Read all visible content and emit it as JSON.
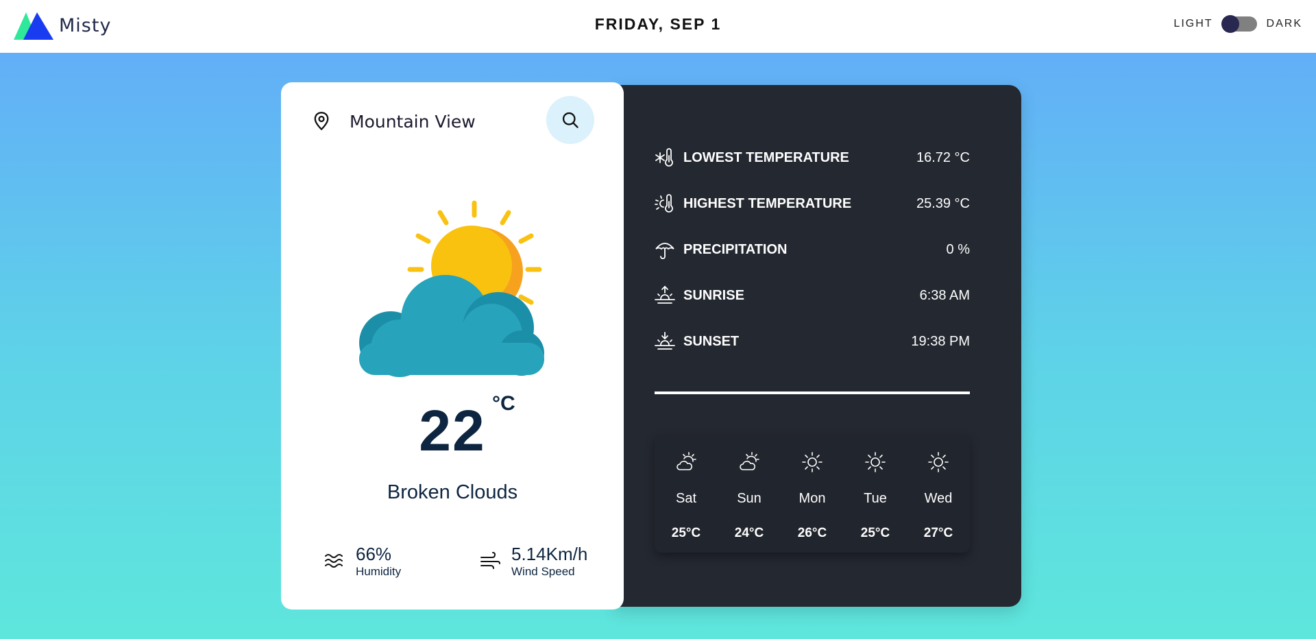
{
  "header": {
    "brand": "Misty",
    "date": "FRIDAY, SEP 1",
    "theme_light_label": "LIGHT",
    "theme_dark_label": "DARK"
  },
  "search": {
    "value": "Mountain View",
    "icons": {
      "location": "map-pin-icon",
      "search": "search-icon"
    }
  },
  "current": {
    "temperature": "22",
    "unit": "°C",
    "condition": "Broken Clouds",
    "icon": "sun-cloud-icon",
    "humidity": {
      "value": "66%",
      "label": "Humidity",
      "icon": "waves-icon"
    },
    "wind": {
      "value": "5.14Km/h",
      "label": "Wind Speed",
      "icon": "wind-icon"
    }
  },
  "details": [
    {
      "label": "LOWEST TEMPERATURE",
      "value": "16.72 °C",
      "icon": "thermometer-snow-icon"
    },
    {
      "label": "HIGHEST TEMPERATURE",
      "value": "25.39 °C",
      "icon": "thermometer-sun-icon"
    },
    {
      "label": "PRECIPITATION",
      "value": "0 %",
      "icon": "umbrella-icon"
    },
    {
      "label": "SUNRISE",
      "value": "6:38 AM",
      "icon": "sunrise-icon"
    },
    {
      "label": "SUNSET",
      "value": "19:38 PM",
      "icon": "sunset-icon"
    }
  ],
  "forecast": [
    {
      "day": "Sat",
      "temp": "25°C",
      "icon": "cloud-sun-icon"
    },
    {
      "day": "Sun",
      "temp": "24°C",
      "icon": "cloud-sun-icon"
    },
    {
      "day": "Mon",
      "temp": "26°C",
      "icon": "sun-icon"
    },
    {
      "day": "Tue",
      "temp": "25°C",
      "icon": "sun-icon"
    },
    {
      "day": "Wed",
      "temp": "27°C",
      "icon": "sun-icon"
    }
  ],
  "colors": {
    "panel_dark": "#242831",
    "accent_light": "#dbf1fb",
    "text_dark": "#0d2540"
  }
}
